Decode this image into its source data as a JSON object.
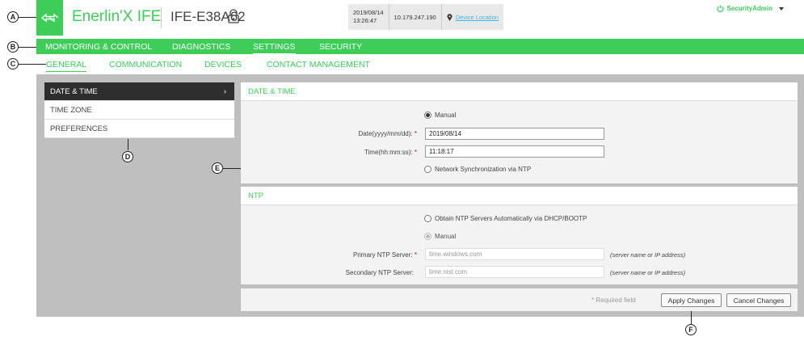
{
  "callouts": {
    "a": "A",
    "b": "B",
    "c": "C",
    "d": "D",
    "e": "E",
    "f": "F"
  },
  "header": {
    "app_title": "Enerlin'X IFE",
    "device_name": "IFE-E38A62",
    "date": "2019/08/14",
    "time": "13:26:47",
    "ip": "10.179.247.190",
    "location_link": "Device Location",
    "user": "SecurityAdmin"
  },
  "nav": {
    "items": [
      "MONITORING & CONTROL",
      "DIAGNOSTICS",
      "SETTINGS",
      "SECURITY"
    ],
    "active": "SETTINGS"
  },
  "subnav": {
    "items": [
      "GENERAL",
      "COMMUNICATION",
      "DEVICES",
      "CONTACT MANAGEMENT"
    ],
    "active": "GENERAL"
  },
  "sidebar": {
    "items": [
      "DATE & TIME",
      "TIME ZONE",
      "PREFERENCES"
    ],
    "active_arrow": "›"
  },
  "datetime": {
    "title": "DATE & TIME",
    "manual_label": "Manual",
    "date_label": "Date(yyyy/mm/dd):",
    "date_value": "2019/08/14",
    "time_label": "Time(hh:mm:ss):",
    "time_value": "11:18:17",
    "ntp_sync_label": "Network Synchronization via NTP",
    "required_mark": "*"
  },
  "ntp": {
    "title": "NTP",
    "auto_label": "Obtain NTP Servers Automatically via DHCP/BOOTP",
    "manual_label": "Manual",
    "primary_label": "Primary NTP Server:",
    "primary_placeholder": "time.windows.com",
    "secondary_label": "Secondary NTP Server:",
    "secondary_placeholder": "time.nist.com",
    "hint": "(server name or IP address)"
  },
  "footer": {
    "required_note": "* Required field",
    "apply": "Apply Changes",
    "cancel": "Cancel Changes"
  },
  "colors": {
    "brand": "#3dcd58",
    "dark": "#2e2e2e",
    "frame": "#bfbfbf"
  }
}
